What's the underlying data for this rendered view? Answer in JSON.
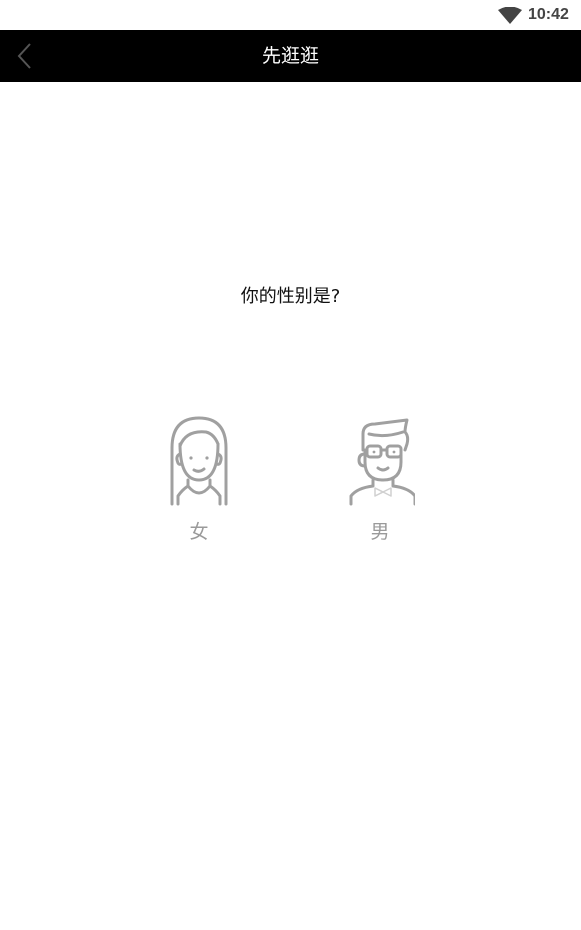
{
  "status_bar": {
    "time": "10:42",
    "wifi_icon": "wifi-icon"
  },
  "header": {
    "back_icon": "chevron-left-icon",
    "title": "先逛逛",
    "background": "#000000"
  },
  "main": {
    "question": "你的性别是?",
    "options": [
      {
        "label": "女",
        "icon": "female-avatar-icon"
      },
      {
        "label": "男",
        "icon": "male-avatar-icon"
      }
    ],
    "icon_color": "#a0a0a0"
  }
}
